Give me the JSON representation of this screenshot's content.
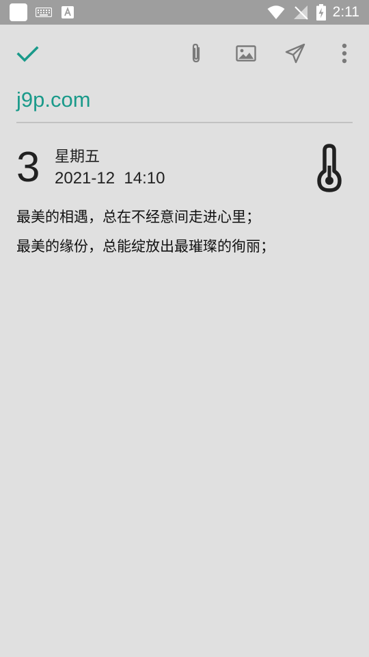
{
  "status_bar": {
    "time": "2:11",
    "icons": [
      "app-square-icon",
      "keyboard-icon",
      "font-a-icon",
      "wifi-icon",
      "no-signal-icon",
      "battery-charging-icon"
    ]
  },
  "toolbar": {
    "icons": [
      "check-icon",
      "attach-icon",
      "image-icon",
      "send-icon",
      "more-vert-icon"
    ],
    "accent_color": "#1a9a8a"
  },
  "note": {
    "title": "j9p.com",
    "day": "3",
    "weekday": "星期五",
    "datetime": "2021-12  14:10",
    "weather_icon": "thermometer-icon",
    "lines": [
      "最美的相遇，总在不经意间走进心里；",
      "最美的缘份，总能绽放出最璀璨的徇丽；"
    ]
  }
}
